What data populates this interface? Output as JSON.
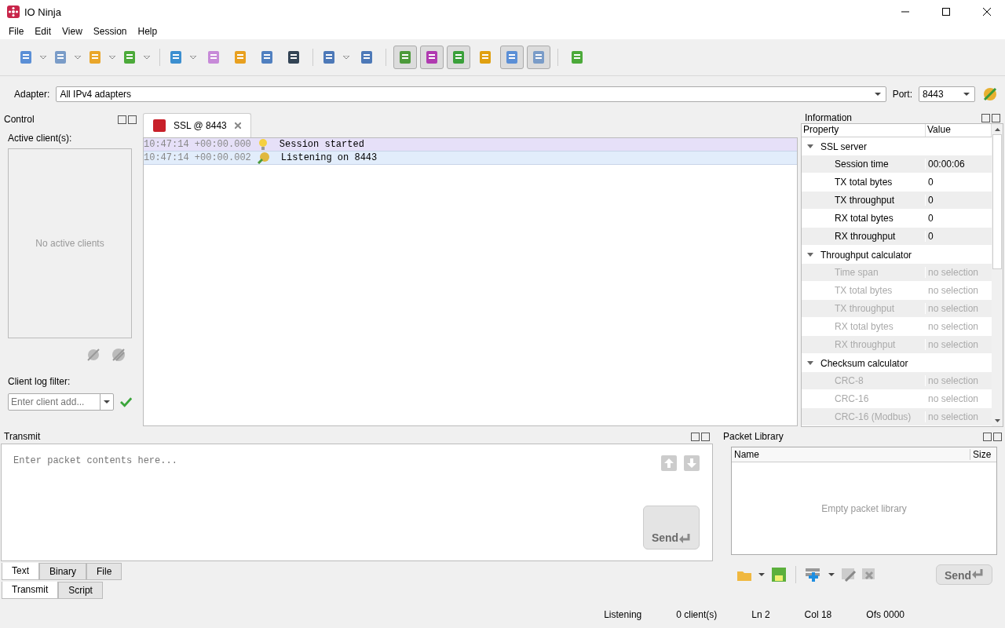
{
  "window": {
    "title": "IO Ninja"
  },
  "menu": [
    "File",
    "Edit",
    "View",
    "Session",
    "Help"
  ],
  "toolbar": [
    {
      "kind": "button",
      "dropdown": true,
      "pressed": false
    },
    {
      "kind": "button",
      "dropdown": true,
      "pressed": false
    },
    {
      "kind": "button",
      "dropdown": true,
      "pressed": false
    },
    {
      "kind": "button",
      "dropdown": true,
      "pressed": false
    },
    {
      "kind": "separator"
    },
    {
      "kind": "button",
      "dropdown": true,
      "pressed": false
    },
    {
      "kind": "button",
      "dropdown": false,
      "pressed": false
    },
    {
      "kind": "button",
      "dropdown": false,
      "pressed": false
    },
    {
      "kind": "button",
      "dropdown": false,
      "pressed": false
    },
    {
      "kind": "button",
      "dropdown": false,
      "pressed": false
    },
    {
      "kind": "separator"
    },
    {
      "kind": "button",
      "dropdown": true,
      "pressed": false
    },
    {
      "kind": "button",
      "dropdown": false,
      "pressed": false
    },
    {
      "kind": "separator"
    },
    {
      "kind": "button",
      "dropdown": false,
      "pressed": true
    },
    {
      "kind": "button",
      "dropdown": false,
      "pressed": true
    },
    {
      "kind": "button",
      "dropdown": false,
      "pressed": true
    },
    {
      "kind": "button",
      "dropdown": false,
      "pressed": false
    },
    {
      "kind": "button",
      "dropdown": false,
      "pressed": true
    },
    {
      "kind": "button",
      "dropdown": false,
      "pressed": true
    },
    {
      "kind": "separator"
    },
    {
      "kind": "button",
      "dropdown": false,
      "pressed": false
    }
  ],
  "adapter_bar": {
    "adapter_label": "Adapter:",
    "adapter": "All IPv4 adapters",
    "port_label": "Port:",
    "port": "8443"
  },
  "control": {
    "title": "Control",
    "clients_label": "Active client(s):",
    "clients_empty": "No active clients",
    "filter_label": "Client log filter:",
    "filter_placeholder": "Enter client add..."
  },
  "session_tab": {
    "label": "SSL @ 8443",
    "selected": true
  },
  "log": [
    {
      "time": "10:47:14 +00:00.000",
      "text": "Session started",
      "color": "#e6e0f8",
      "kind": "info"
    },
    {
      "time": "10:47:14 +00:00.002",
      "text": "Listening on 8443",
      "color": "#e2edfb",
      "kind": "listen"
    }
  ],
  "information": {
    "title": "Information",
    "columns": [
      "Property",
      "Value"
    ],
    "groups": [
      {
        "name": "SSL server",
        "expanded": true,
        "children": [
          {
            "name": "Session time",
            "value": "00:00:06",
            "disabled": false
          },
          {
            "name": "TX total bytes",
            "value": "0",
            "disabled": false
          },
          {
            "name": "TX throughput",
            "value": "0",
            "disabled": false
          },
          {
            "name": "RX total bytes",
            "value": "0",
            "disabled": false
          },
          {
            "name": "RX throughput",
            "value": "0",
            "disabled": false
          }
        ]
      },
      {
        "name": "Throughput calculator",
        "expanded": true,
        "children": [
          {
            "name": "Time span",
            "value": "no selection",
            "disabled": true
          },
          {
            "name": "TX total bytes",
            "value": "no selection",
            "disabled": true
          },
          {
            "name": "TX throughput",
            "value": "no selection",
            "disabled": true
          },
          {
            "name": "RX total bytes",
            "value": "no selection",
            "disabled": true
          },
          {
            "name": "RX throughput",
            "value": "no selection",
            "disabled": true
          }
        ]
      },
      {
        "name": "Checksum calculator",
        "expanded": true,
        "children": [
          {
            "name": "CRC-8",
            "value": "no selection",
            "disabled": true
          },
          {
            "name": "CRC-16",
            "value": "no selection",
            "disabled": true
          },
          {
            "name": "CRC-16 (Modbus)",
            "value": "no selection",
            "disabled": true
          }
        ]
      }
    ]
  },
  "transmit": {
    "title": "Transmit",
    "placeholder": "Enter packet contents here...",
    "send": "Send",
    "format_tabs": [
      {
        "label": "Text",
        "selected": true
      },
      {
        "label": "Binary",
        "selected": false
      },
      {
        "label": "File",
        "selected": false
      }
    ],
    "mode_tabs": [
      {
        "label": "Transmit",
        "selected": true
      },
      {
        "label": "Script",
        "selected": false
      }
    ]
  },
  "packet_library": {
    "title": "Packet Library",
    "columns": [
      "Name",
      "Size"
    ],
    "empty": "Empty packet library",
    "send": "Send"
  },
  "status_bar": [
    "Listening",
    "0 client(s)",
    "Ln 2",
    "Col 18",
    "Ofs 0000"
  ]
}
